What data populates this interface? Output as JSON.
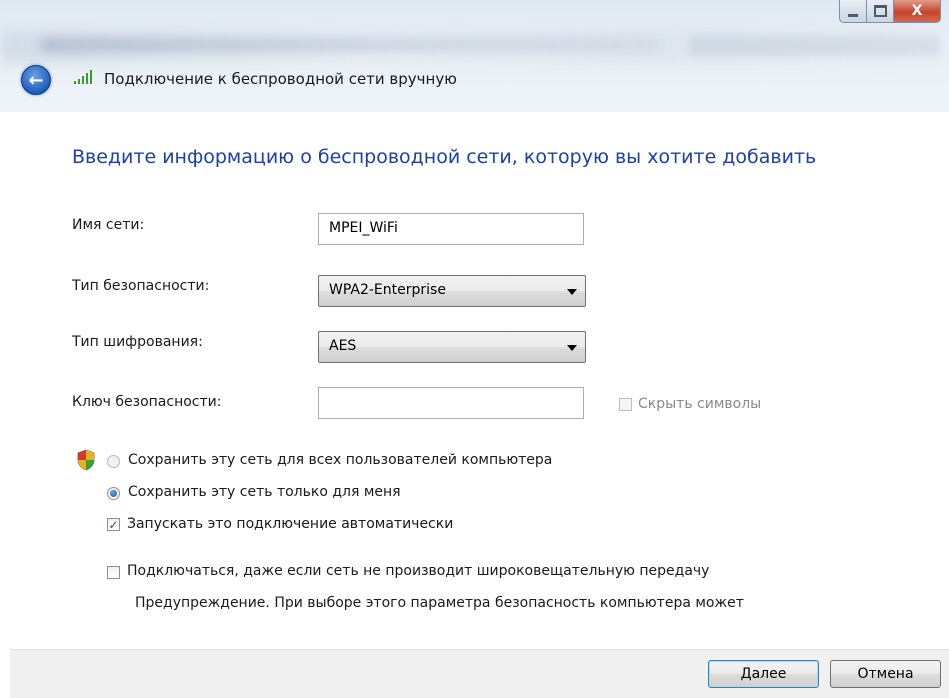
{
  "window": {
    "title": "Подключение к беспроводной сети вручную",
    "close_glyph": "X"
  },
  "main": {
    "heading": "Введите информацию о беспроводной сети, которую вы хотите добавить"
  },
  "form": {
    "network_name": {
      "label": "Имя сети:",
      "value": "MPEI_WiFi"
    },
    "security_type": {
      "label": "Тип безопасности:",
      "value": "WPA2-Enterprise"
    },
    "encryption_type": {
      "label": "Тип шифрования:",
      "value": "AES"
    },
    "security_key": {
      "label": "Ключ безопасности:",
      "value": ""
    },
    "hide_characters": {
      "label": "Скрыть символы",
      "checked": false,
      "enabled": false
    }
  },
  "options": {
    "save_all_users": {
      "label": "Сохранить эту сеть для всех пользователей компьютера",
      "checked": false,
      "enabled": false
    },
    "save_me_only": {
      "label": "Сохранить эту сеть только для меня",
      "checked": true
    },
    "auto_connect": {
      "label": "Запускать это подключение автоматически",
      "checked": true,
      "glyph": "✓"
    },
    "connect_hidden": {
      "label": "Подключаться, даже если сеть не производит широковещательную передачу",
      "checked": false
    },
    "warning": "Предупреждение. При выборе этого параметра безопасность компьютера может"
  },
  "footer": {
    "next_label": "Далее",
    "cancel_label": "Отмена"
  },
  "colors": {
    "heading": "#1c3fa8",
    "back_button": "#1f5dbb",
    "close_button": "#c6432a"
  },
  "icons": [
    "back-arrow-icon",
    "wireless-signal-icon",
    "uac-shield-icon",
    "minimize-icon",
    "maximize-icon",
    "close-icon",
    "dropdown-arrow-icon"
  ]
}
